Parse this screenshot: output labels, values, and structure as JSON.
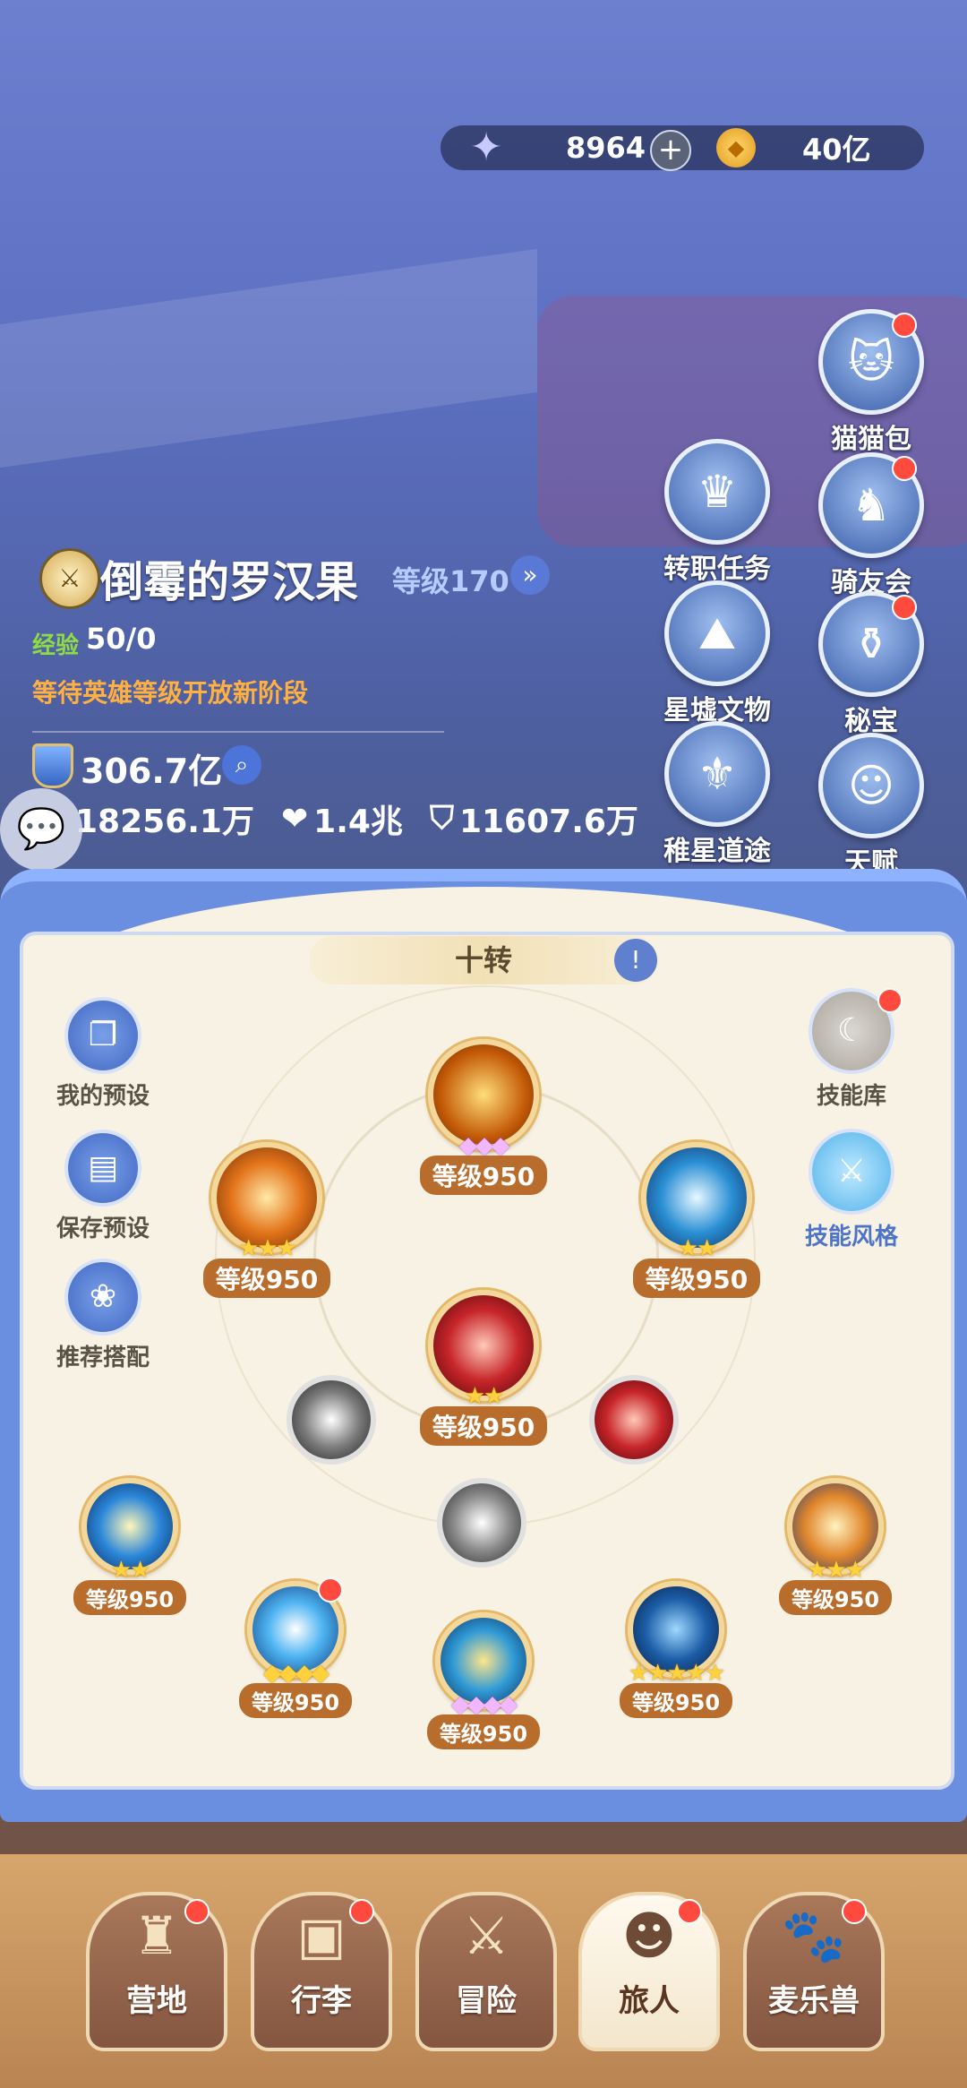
{
  "currency": {
    "stars": "8964",
    "gold": "40亿"
  },
  "side_buttons": [
    {
      "label": "猫猫包",
      "icon": "cat-bag-icon",
      "badge": true
    },
    {
      "label": "转职任务",
      "icon": "crown-icon",
      "badge": false
    },
    {
      "label": "骑友会",
      "icon": "horse-icon",
      "badge": true
    },
    {
      "label": "星墟文物",
      "icon": "relic-icon",
      "badge": false
    },
    {
      "label": "秘宝",
      "icon": "treasure-icon",
      "badge": true
    },
    {
      "label": "稚星道途",
      "icon": "star-path-icon",
      "badge": false
    },
    {
      "label": "天赋",
      "icon": "talent-icon",
      "badge": false
    }
  ],
  "player": {
    "name": "倒霉的罗汉果",
    "level": "等级170",
    "exp_label": "经验",
    "exp_value": "50/0",
    "notice": "等待英雄等级开放新阶段",
    "power": "306.7亿",
    "attack": "18256.1万",
    "hp": "1.4兆",
    "defense": "11607.6万"
  },
  "panel": {
    "title": "十转",
    "left_tools": [
      {
        "label": "我的预设",
        "icon": "preset-icon"
      },
      {
        "label": "保存预设",
        "icon": "save-icon"
      },
      {
        "label": "推荐搭配",
        "icon": "recommend-icon"
      }
    ],
    "right_tools": [
      {
        "label": "技能库",
        "icon": "skill-library-icon",
        "badge": true
      },
      {
        "label": "技能风格",
        "icon": "skill-style-icon",
        "badge": false
      }
    ],
    "skills": [
      {
        "level": "等级950",
        "stars": "◆◆◆"
      },
      {
        "level": "等级950",
        "stars": "★★★"
      },
      {
        "level": "等级950",
        "stars": "★★"
      },
      {
        "level": "等级950",
        "stars": "★★"
      },
      {
        "level": "等级950",
        "stars": "★★"
      },
      {
        "level": "等级950",
        "stars": "★★★"
      },
      {
        "level": "等级950",
        "stars": "◆◆◆◆"
      },
      {
        "level": "等级950",
        "stars": "★★★★★"
      },
      {
        "level": "等级950",
        "stars": "★★★"
      }
    ]
  },
  "nav": [
    {
      "label": "营地",
      "icon": "castle-icon"
    },
    {
      "label": "行李",
      "icon": "backpack-icon"
    },
    {
      "label": "冒险",
      "icon": "swords-icon"
    },
    {
      "label": "旅人",
      "icon": "traveler-icon"
    },
    {
      "label": "麦乐兽",
      "icon": "pet-icon"
    }
  ]
}
